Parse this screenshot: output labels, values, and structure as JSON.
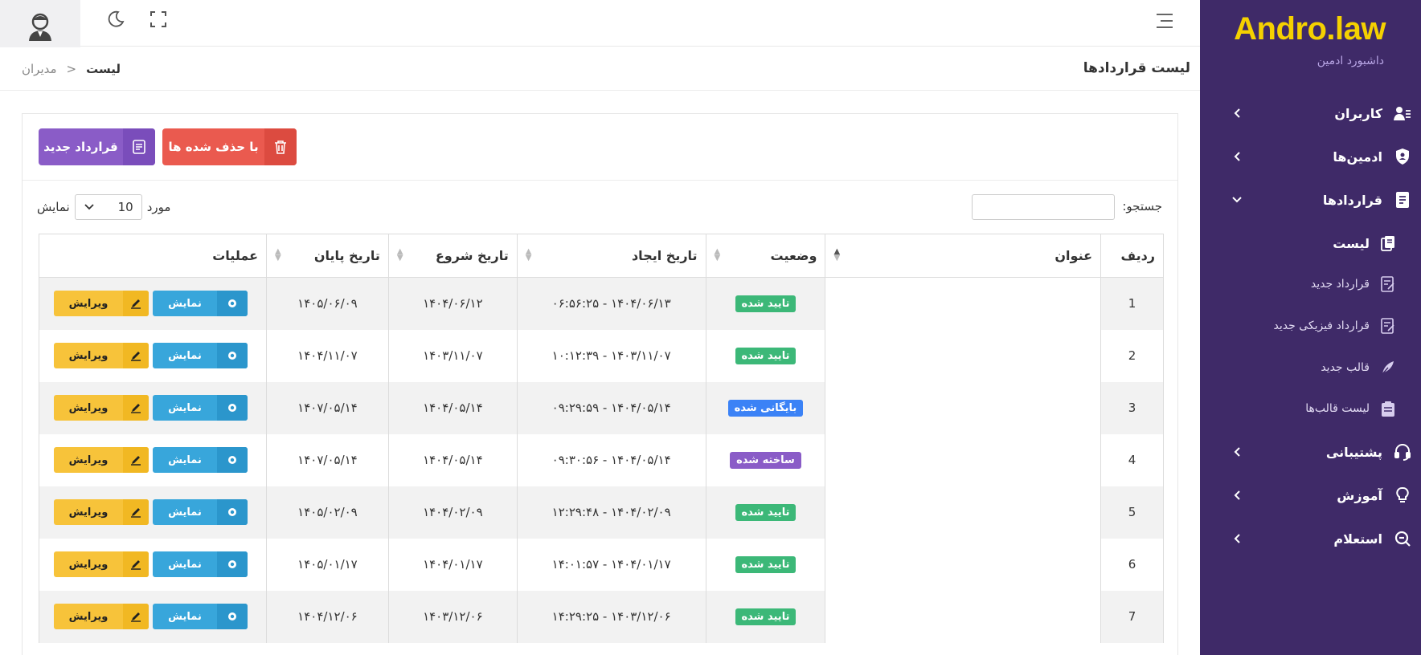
{
  "brand": {
    "name": "Andro.law",
    "subtitle": "داشبورد ادمین"
  },
  "sidebar": {
    "items": [
      {
        "label": "کاربران",
        "icon": "users-icon"
      },
      {
        "label": "ادمین‌ها",
        "icon": "shield-icon"
      },
      {
        "label": "قراردادها",
        "icon": "document-icon",
        "expanded": true
      },
      {
        "label": "پشتیبانی",
        "icon": "headset-icon"
      },
      {
        "label": "آموزش",
        "icon": "lightbulb-icon"
      },
      {
        "label": "استعلام",
        "icon": "search-doc-icon"
      }
    ],
    "subitems": [
      {
        "label": "لیست",
        "icon": "copy-icon",
        "active": true
      },
      {
        "label": "قرارداد جدید",
        "icon": "edit-doc-icon"
      },
      {
        "label": "قرارداد فیزیکی جدید",
        "icon": "edit-doc-icon"
      },
      {
        "label": "قالب جدید",
        "icon": "feather-icon"
      },
      {
        "label": "لیست قالب‌ها",
        "icon": "clipboard-icon"
      }
    ]
  },
  "header": {
    "page_title": "لیست قراردادها",
    "breadcrumb": {
      "current": "لیست",
      "parent": "مدیران",
      "sep": "<"
    }
  },
  "toolbar": {
    "new_label": "قرارداد جدید",
    "deleted_label": "با حذف شده ها"
  },
  "filters": {
    "search_label": "جستجو:",
    "show_label": "نمایش",
    "entries_value": "10",
    "entries_suffix": "مورد"
  },
  "table": {
    "columns": [
      "ردیف",
      "عنوان",
      "وضعیت",
      "تاریخ ایجاد",
      "تاریخ شروع",
      "تاریخ پایان",
      "عملیات"
    ],
    "show_label": "نمایش",
    "edit_label": "ویرایش",
    "rows": [
      {
        "idx": "1",
        "status": "تایید شده",
        "status_color": "#3cb878",
        "created": "۱۴۰۴/۰۶/۱۳ - ۰۶:۵۶:۲۵",
        "start": "۱۴۰۴/۰۶/۱۲",
        "end": "۱۴۰۵/۰۶/۰۹"
      },
      {
        "idx": "2",
        "status": "تایید شده",
        "status_color": "#3cb878",
        "created": "۱۴۰۳/۱۱/۰۷ - ۱۰:۱۲:۳۹",
        "start": "۱۴۰۳/۱۱/۰۷",
        "end": "۱۴۰۴/۱۱/۰۷"
      },
      {
        "idx": "3",
        "status": "بایگانی شده",
        "status_color": "#3b82f6",
        "created": "۱۴۰۴/۰۵/۱۴ - ۰۹:۲۹:۵۹",
        "start": "۱۴۰۴/۰۵/۱۴",
        "end": "۱۴۰۷/۰۵/۱۴"
      },
      {
        "idx": "4",
        "status": "ساخته شده",
        "status_color": "#8a5cc7",
        "created": "۱۴۰۴/۰۵/۱۴ - ۰۹:۳۰:۵۶",
        "start": "۱۴۰۴/۰۵/۱۴",
        "end": "۱۴۰۷/۰۵/۱۴"
      },
      {
        "idx": "5",
        "status": "تایید شده",
        "status_color": "#3cb878",
        "created": "۱۴۰۴/۰۲/۰۹ - ۱۲:۲۹:۴۸",
        "start": "۱۴۰۴/۰۲/۰۹",
        "end": "۱۴۰۵/۰۲/۰۹"
      },
      {
        "idx": "6",
        "status": "تایید شده",
        "status_color": "#3cb878",
        "created": "۱۴۰۴/۰۱/۱۷ - ۱۴:۰۱:۵۷",
        "start": "۱۴۰۴/۰۱/۱۷",
        "end": "۱۴۰۵/۰۱/۱۷"
      },
      {
        "idx": "7",
        "status": "تایید شده",
        "status_color": "#3cb878",
        "created": "۱۴۰۳/۱۲/۰۶ - ۱۴:۲۹:۲۵",
        "start": "۱۴۰۳/۱۲/۰۶",
        "end": "۱۴۰۴/۱۲/۰۶"
      }
    ]
  }
}
